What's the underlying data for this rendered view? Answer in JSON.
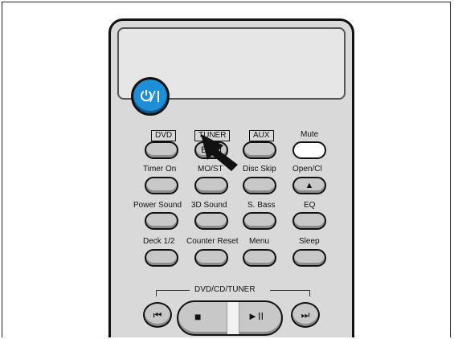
{
  "power": {
    "label": "⏻/I"
  },
  "row1": [
    {
      "label": "DVD",
      "boxed": true,
      "button_text": ""
    },
    {
      "label": "TUNER",
      "boxed": true,
      "button_text": "Band"
    },
    {
      "label": "AUX",
      "boxed": true,
      "button_text": ""
    },
    {
      "label": "Mute",
      "boxed": false,
      "button_text": ""
    }
  ],
  "row2": [
    {
      "label": "Timer On",
      "button_text": ""
    },
    {
      "label": "MO/ST",
      "button_text": ""
    },
    {
      "label": "Disc Skip",
      "button_text": ""
    },
    {
      "label": "Open/Cl",
      "button_text": "▲"
    }
  ],
  "row3": [
    {
      "label": "Power Sound",
      "button_text": ""
    },
    {
      "label": "3D Sound",
      "button_text": ""
    },
    {
      "label": "S. Bass",
      "button_text": ""
    },
    {
      "label": "EQ",
      "button_text": ""
    }
  ],
  "row4": [
    {
      "label": "Deck 1/2",
      "button_text": ""
    },
    {
      "label": "Counter Reset",
      "button_text": ""
    },
    {
      "label": "Menu",
      "button_text": ""
    },
    {
      "label": "Sleep",
      "button_text": ""
    }
  ],
  "transport": {
    "section_label": "DVD/CD/TUNER",
    "prev": "⏮",
    "stop": "■",
    "play_pause": "►II",
    "next": "⏭"
  },
  "colors": {
    "power": "#1e8fd6",
    "body": "#d9d9d9",
    "button": "#c8c8c8"
  }
}
